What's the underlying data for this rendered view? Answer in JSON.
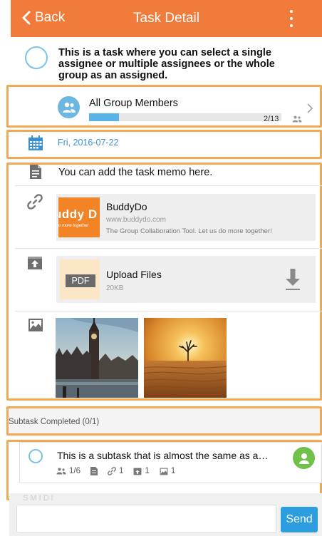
{
  "header": {
    "back_label": "Back",
    "title": "Task Detail",
    "back_icon": "chevron-left",
    "menu_icon": "vertical-dots",
    "color": "#f07b3a"
  },
  "task": {
    "title": "This is a task where you can select a single assignee or multiple assignees or the whole group as an assigned."
  },
  "assignees": {
    "label": "All Group Members",
    "progress_text": "2/13",
    "progress_fraction": 0.154,
    "progress_color": "#58b3e6"
  },
  "due": {
    "date": "Fri, 2016-07-22",
    "icon": "calendar"
  },
  "memo": {
    "text": "You can add the task memo here."
  },
  "link": {
    "thumb_text": "uddy D",
    "thumb_subtext": "o more together",
    "title": "BuddyDo",
    "url": "www.buddydo.com",
    "description": "The Group Collaboration Tool. Let us do more together!"
  },
  "file": {
    "badge": "PDF",
    "name": "Upload Files",
    "size": "20KB"
  },
  "photos": [
    {
      "icon": "london-big-ben-photo"
    },
    {
      "icon": "desert-tree-sunset-photo"
    }
  ],
  "subtasks": {
    "header": "Subtask Completed (0/1)",
    "items": [
      {
        "title": "This is a subtask that is almost the same as a…",
        "assignees": "1/6",
        "links": "1",
        "files": "1",
        "images": "1"
      }
    ]
  },
  "footer": {
    "send_label": "Send",
    "hint": "S    M    I    D    l"
  },
  "colors": {
    "accent": "#f07b3a",
    "highlight_box": "#f3a853",
    "link_blue": "#3a8fd0",
    "send_blue": "#2c9ee0"
  }
}
